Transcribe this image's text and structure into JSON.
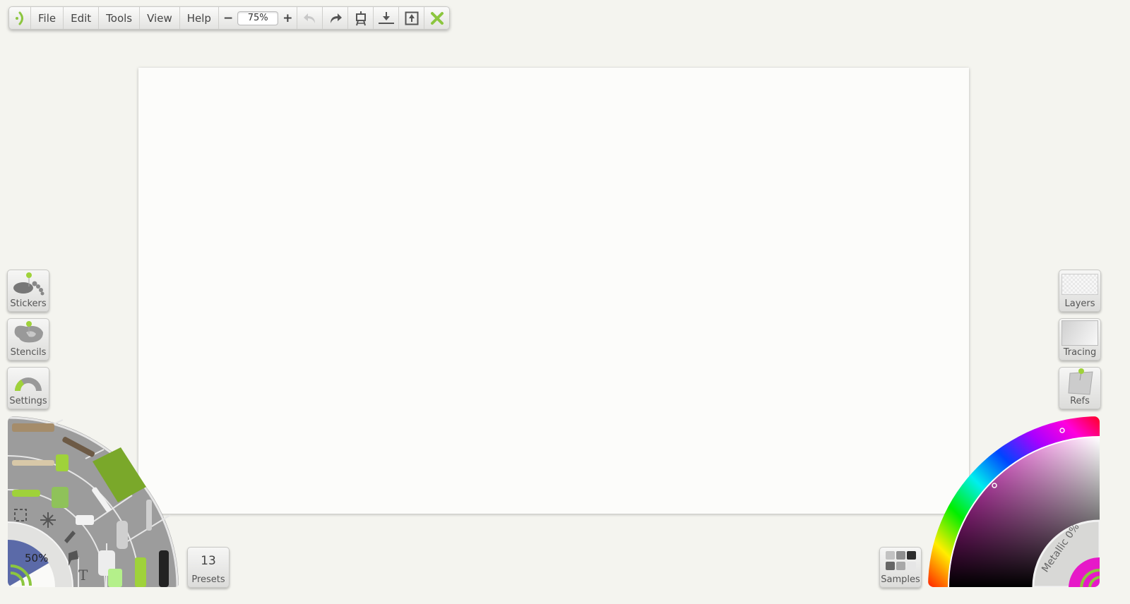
{
  "toolbar": {
    "logo_icon": "app-logo-icon",
    "menus": [
      "File",
      "Edit",
      "Tools",
      "View",
      "Help"
    ],
    "zoom_out_label": "−",
    "zoom_value": "75%",
    "zoom_in_label": "+",
    "icons": [
      "undo-icon",
      "redo-icon",
      "easel-icon",
      "import-icon",
      "export-icon",
      "close-icon"
    ]
  },
  "left_tiles": [
    {
      "label": "Stickers",
      "icon": "stickers-icon"
    },
    {
      "label": "Stencils",
      "icon": "stencils-icon"
    },
    {
      "label": "Settings",
      "icon": "settings-icon"
    }
  ],
  "right_tiles": [
    {
      "label": "Layers",
      "icon": "layers-icon"
    },
    {
      "label": "Tracing",
      "icon": "tracing-icon"
    },
    {
      "label": "Refs",
      "icon": "refs-icon"
    }
  ],
  "presets": {
    "count": "13",
    "label": "Presets"
  },
  "samples": {
    "label": "Samples"
  },
  "tool_wheel": {
    "opacity_label": "50%",
    "tools": [
      "flat-brush",
      "round-brush",
      "palette-knife",
      "pencil",
      "paint-roller",
      "felt-pen",
      "crayon",
      "chalk",
      "ink-pen",
      "airbrush",
      "select",
      "transform",
      "eyedropper",
      "marker",
      "fill-bucket",
      "paint-tube",
      "text",
      "glitter-tube",
      "sticker-spray",
      "technical-pen"
    ]
  },
  "color_wheel": {
    "metallic_label": "Metallic 0%",
    "current_color": "#e619c8",
    "accent": "#8cc63f"
  }
}
